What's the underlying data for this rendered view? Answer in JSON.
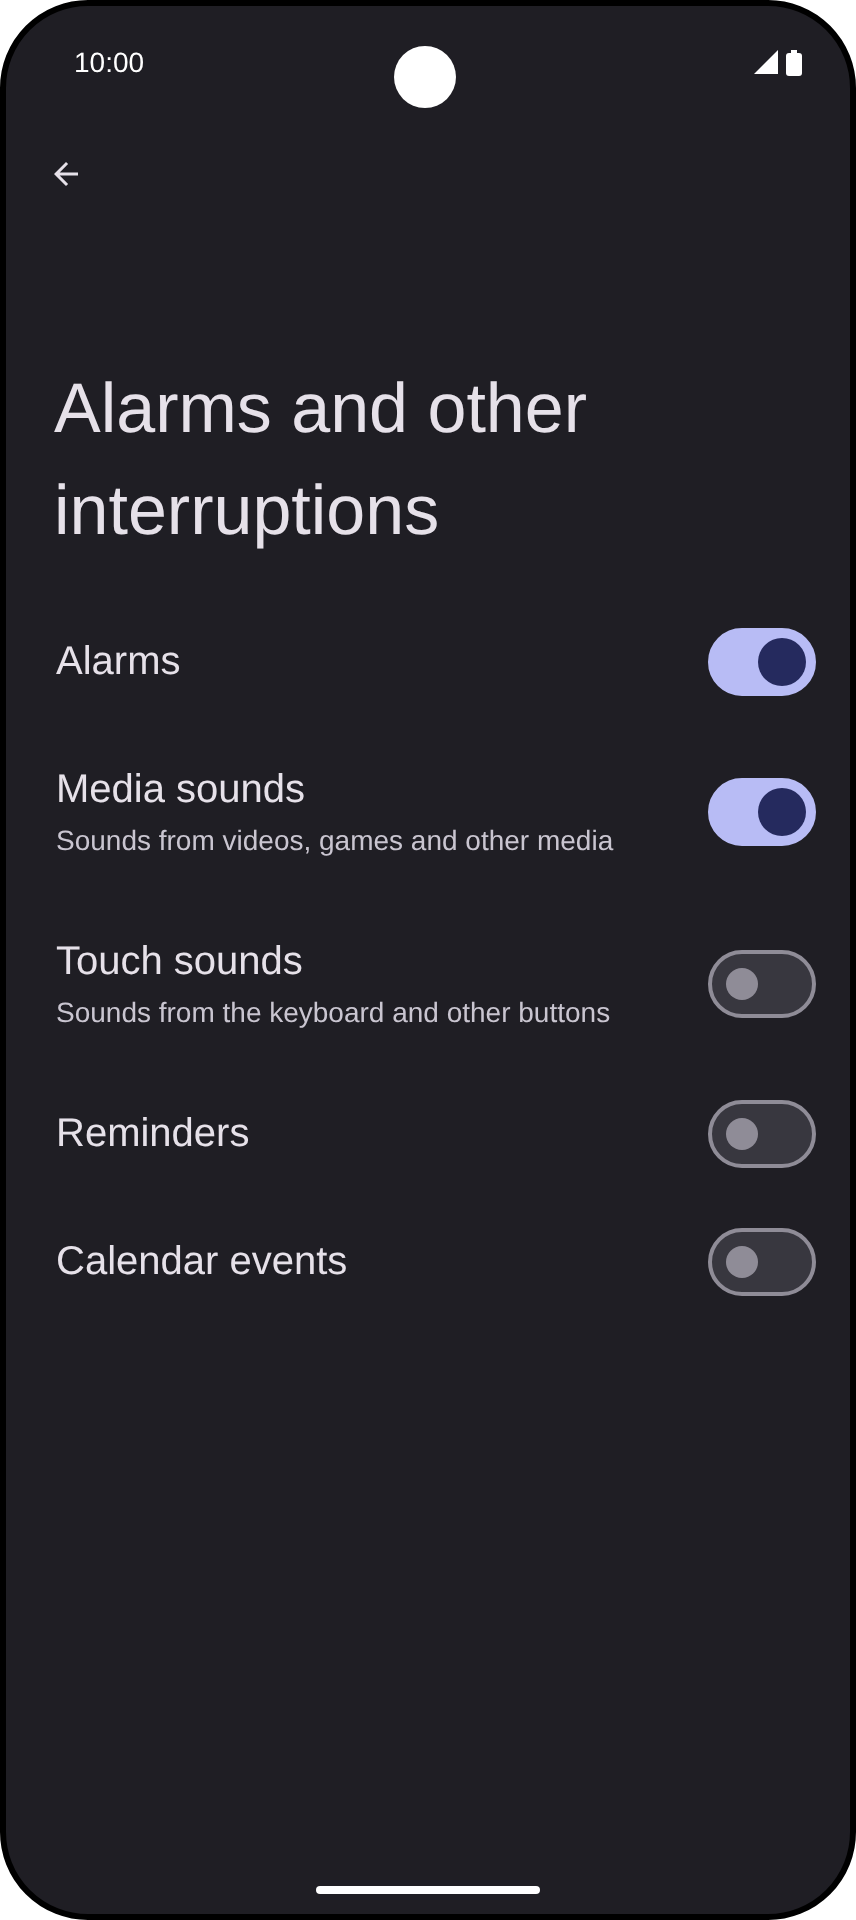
{
  "status_bar": {
    "time": "10:00"
  },
  "title": "Alarms and other interruptions",
  "settings": [
    {
      "label": "Alarms",
      "on": true
    },
    {
      "label": "Media sounds",
      "summary": "Sounds from videos, games and other media",
      "on": true
    },
    {
      "label": "Touch sounds",
      "summary": "Sounds from the keyboard and other buttons",
      "on": false
    },
    {
      "label": "Reminders",
      "on": false
    },
    {
      "label": "Calendar events",
      "on": false
    }
  ]
}
